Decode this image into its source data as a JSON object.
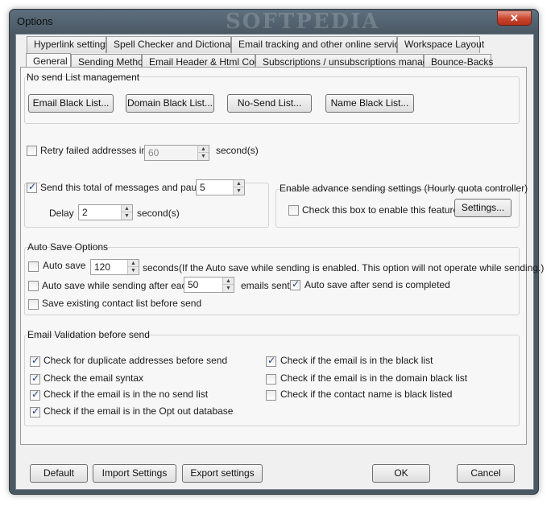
{
  "window": {
    "title": "Options",
    "watermark": "SOFTPEDIA",
    "close_glyph": "✕"
  },
  "tabs_row1": [
    {
      "label": "Hyperlink settings"
    },
    {
      "label": "Spell Checker and Dictionary"
    },
    {
      "label": "Email tracking and other online services"
    },
    {
      "label": "Workspace Layout"
    }
  ],
  "tabs_row2": [
    {
      "label": "General",
      "active": true
    },
    {
      "label": "Sending Method"
    },
    {
      "label": "Email Header & Html Code"
    },
    {
      "label": "Subscriptions / unsubscriptions manager"
    },
    {
      "label": "Bounce-Backs"
    }
  ],
  "nosend": {
    "title": "No send List management",
    "buttons": [
      "Email Black List...",
      "Domain Black List...",
      "No-Send List...",
      "Name Black List..."
    ]
  },
  "retry": {
    "label": "Retry failed addresses in",
    "value": "60",
    "unit": "second(s)",
    "checked": false
  },
  "pause": {
    "label": "Send this total of messages and pause",
    "value": "5",
    "checked": true,
    "delay_label": "Delay",
    "delay_value": "2",
    "delay_unit": "second(s)"
  },
  "advanced": {
    "title": "Enable advance sending  settings (Hourly quota controller)",
    "check_label": "Check this box to enable this feature",
    "checked": false,
    "settings_button": "Settings..."
  },
  "autosave": {
    "title": "Auto Save Options",
    "autosave_label": "Auto save",
    "autosave_value": "120",
    "seconds": "seconds",
    "note": "(If the Auto save while sending is enabled. This option will not operate while sending.)",
    "while_sending_label": "Auto save while sending after each",
    "while_sending_value": "50",
    "emails_sent": "emails sent",
    "after_send_label": "Auto save after send is completed",
    "after_send_checked": true,
    "existing_label": "Save existing contact list before send"
  },
  "validation": {
    "title": "Email Validation before send",
    "left": [
      {
        "label": "Check for duplicate addresses before send",
        "checked": true
      },
      {
        "label": "Check the email syntax",
        "checked": true
      },
      {
        "label": "Check if the email is in the no send list",
        "checked": true
      },
      {
        "label": "Check if the email is in the Opt out database",
        "checked": true
      }
    ],
    "right": [
      {
        "label": "Check if the email is in the black list",
        "checked": true
      },
      {
        "label": "Check if the email is in the domain black list",
        "checked": false
      },
      {
        "label": "Check if the contact name is black listed",
        "checked": false
      }
    ]
  },
  "footer": {
    "default": "Default",
    "import": "Import Settings",
    "export": "Export settings",
    "ok": "OK",
    "cancel": "Cancel"
  }
}
